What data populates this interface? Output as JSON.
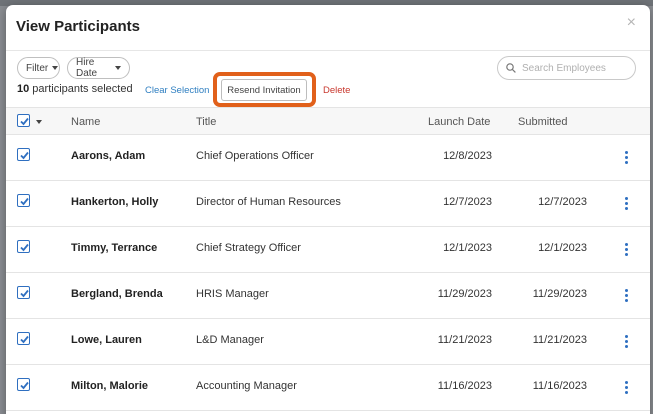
{
  "modal": {
    "title": "View Participants",
    "close_glyph": "×"
  },
  "toolbar": {
    "filter_label": "Filter",
    "hire_date_label": "Hire Date",
    "search_placeholder": "Search Employees",
    "search_value": "",
    "selected_count": "10",
    "selected_suffix": " participants selected",
    "clear_selection": "Clear Selection",
    "resend_invitation": "Resend Invitation",
    "delete": "Delete"
  },
  "colors": {
    "accent_blue": "#2f6fc0",
    "link_blue": "#2f7fc1",
    "delete_red": "#c8372d",
    "highlight_orange": "#e1601a"
  },
  "icons": {
    "search": "search-icon",
    "close": "close-icon",
    "caret": "caret-down-icon",
    "check": "check-icon",
    "more": "more-vertical-icon"
  },
  "table": {
    "columns": {
      "name": "Name",
      "title": "Title",
      "launch_date": "Launch Date",
      "submitted": "Submitted"
    },
    "rows": [
      {
        "name": "Aarons, Adam",
        "title": "Chief Operations Officer",
        "launch": "12/8/2023",
        "submitted": "",
        "checked": true
      },
      {
        "name": "Hankerton, Holly",
        "title": "Director of Human Resources",
        "launch": "12/7/2023",
        "submitted": "12/7/2023",
        "checked": true
      },
      {
        "name": "Timmy, Terrance",
        "title": "Chief Strategy Officer",
        "launch": "12/1/2023",
        "submitted": "12/1/2023",
        "checked": true
      },
      {
        "name": "Bergland, Brenda",
        "title": "HRIS Manager",
        "launch": "11/29/2023",
        "submitted": "11/29/2023",
        "checked": true
      },
      {
        "name": "Lowe, Lauren",
        "title": "L&D Manager",
        "launch": "11/21/2023",
        "submitted": "11/21/2023",
        "checked": true
      },
      {
        "name": "Milton, Malorie",
        "title": "Accounting Manager",
        "launch": "11/16/2023",
        "submitted": "11/16/2023",
        "checked": true
      }
    ]
  }
}
